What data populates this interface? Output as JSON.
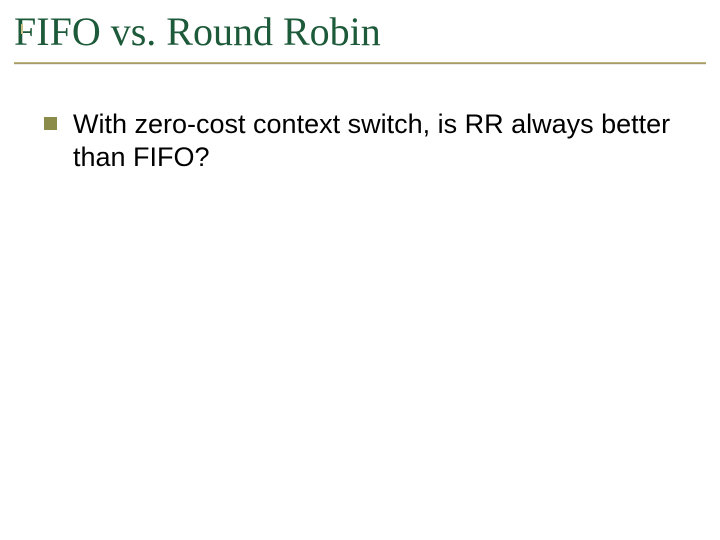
{
  "title": "FIFO vs. Round Robin",
  "bullets": [
    {
      "text": "With zero-cost context switch, is RR always better than FIFO?"
    }
  ]
}
